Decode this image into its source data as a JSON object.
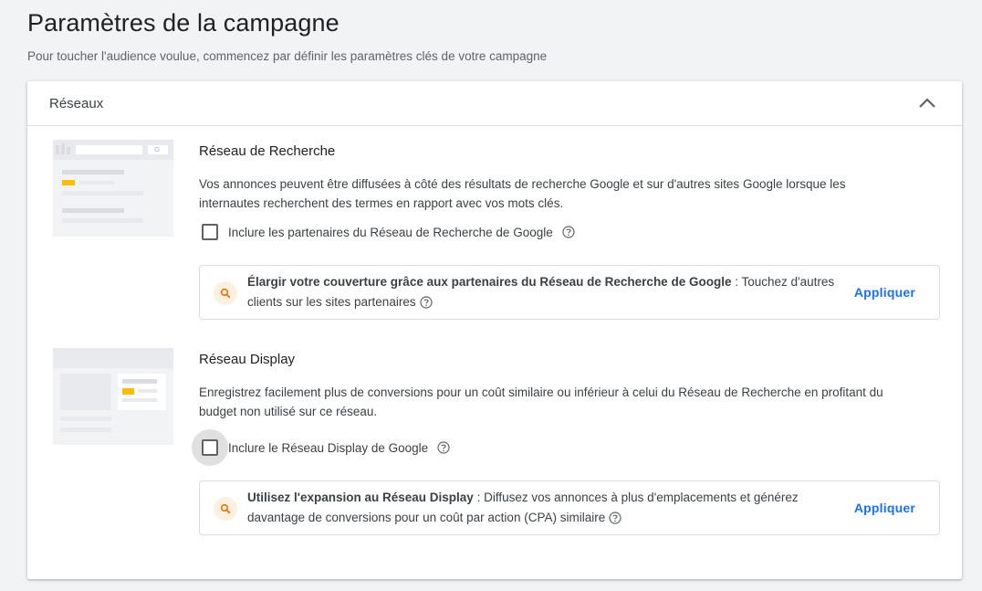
{
  "page": {
    "title": "Paramètres de la campagne",
    "subtitle": "Pour toucher l'audience voulue, commencez par définir les paramètres clés de votre campagne"
  },
  "card": {
    "title": "Réseaux",
    "collapse_icon": "chevron-up-icon"
  },
  "search_network": {
    "title": "Réseau de Recherche",
    "description": "Vos annonces peuvent être diffusées à côté des résultats de recherche Google et sur d'autres sites Google lorsque les internautes recherchent des termes en rapport avec vos mots clés.",
    "checkbox_label": "Inclure les partenaires du Réseau de Recherche de Google",
    "checkbox_checked": false,
    "recommendation": {
      "icon": "search-icon",
      "bold": "Élargir votre couverture grâce aux partenaires du Réseau de Recherche de Google",
      "separator": " : ",
      "text": "Touchez d'autres clients sur les sites partenaires",
      "action": "Appliquer"
    }
  },
  "display_network": {
    "title": "Réseau Display",
    "description": "Enregistrez facilement plus de conversions pour un coût similaire ou inférieur à celui du Réseau de Recherche en profitant du budget non utilisé sur ce réseau.",
    "checkbox_label": "Inclure le Réseau Display de Google",
    "checkbox_checked": false,
    "recommendation": {
      "icon": "search-icon",
      "bold": "Utilisez l'expansion au Réseau Display",
      "separator": " : ",
      "text": "Diffusez vos annonces à plus d'emplacements et générez davantage de conversions pour un coût par action (CPA) similaire",
      "action": "Appliquer"
    }
  },
  "colors": {
    "accent": "#1a73e8",
    "highlight_yellow": "#fbbc04",
    "reco_icon_bg": "#fef0e0",
    "reco_icon_fg": "#e37400"
  }
}
